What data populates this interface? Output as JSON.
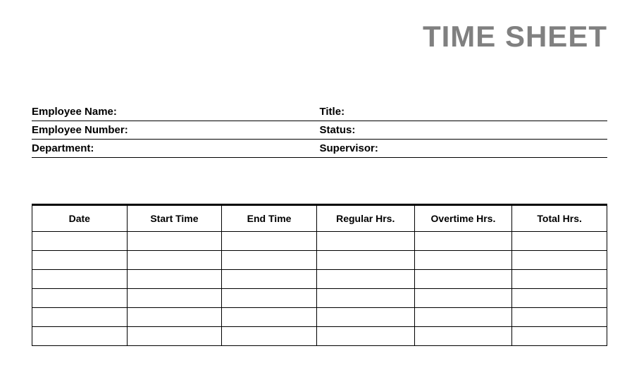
{
  "title": "TIME SHEET",
  "info": {
    "employee_name_label": "Employee Name:",
    "title_label": "Title:",
    "employee_number_label": "Employee Number:",
    "status_label": "Status:",
    "department_label": "Department:",
    "supervisor_label": "Supervisor:"
  },
  "table": {
    "headers": {
      "date": "Date",
      "start_time": "Start Time",
      "end_time": "End Time",
      "regular_hrs": "Regular Hrs.",
      "overtime_hrs": "Overtime Hrs.",
      "total_hrs": "Total Hrs."
    },
    "rows": [
      {
        "date": "",
        "start_time": "",
        "end_time": "",
        "regular_hrs": "",
        "overtime_hrs": "",
        "total_hrs": ""
      },
      {
        "date": "",
        "start_time": "",
        "end_time": "",
        "regular_hrs": "",
        "overtime_hrs": "",
        "total_hrs": ""
      },
      {
        "date": "",
        "start_time": "",
        "end_time": "",
        "regular_hrs": "",
        "overtime_hrs": "",
        "total_hrs": ""
      },
      {
        "date": "",
        "start_time": "",
        "end_time": "",
        "regular_hrs": "",
        "overtime_hrs": "",
        "total_hrs": ""
      },
      {
        "date": "",
        "start_time": "",
        "end_time": "",
        "regular_hrs": "",
        "overtime_hrs": "",
        "total_hrs": ""
      },
      {
        "date": "",
        "start_time": "",
        "end_time": "",
        "regular_hrs": "",
        "overtime_hrs": "",
        "total_hrs": ""
      }
    ]
  }
}
